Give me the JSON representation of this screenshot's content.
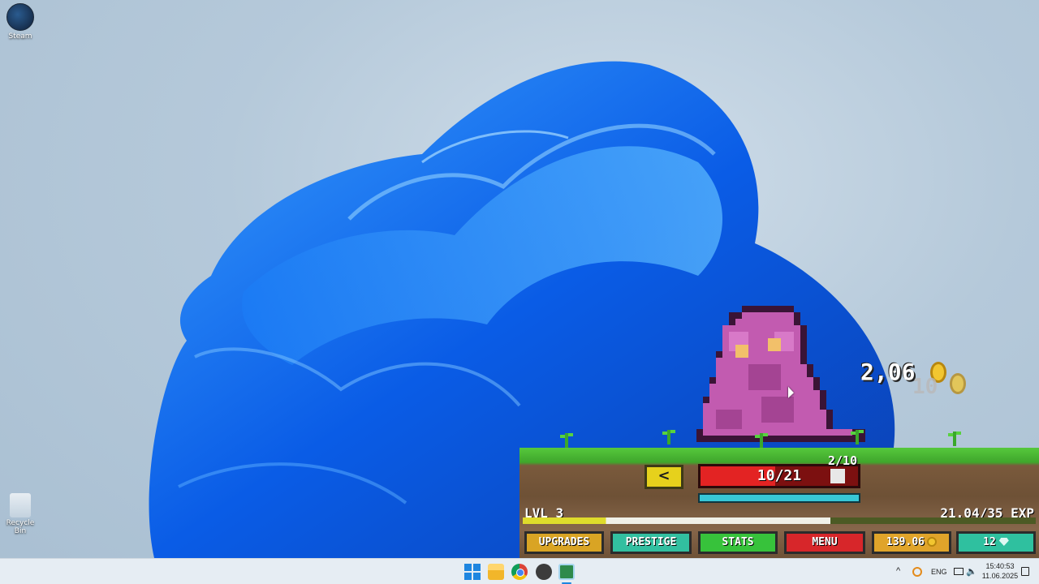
{
  "desktop": {
    "icons": [
      {
        "label": "Steam"
      },
      {
        "label": "Recycle Bin"
      }
    ]
  },
  "game": {
    "damage_number": "2,06",
    "damage_number_faded": "10",
    "wave_counter": "2/10",
    "enemy_hp": {
      "text": "10/21",
      "fraction": 0.476
    },
    "shield_fraction": 1.0,
    "level_label": "LVL 3",
    "exp_text": "21.04/35 EXP",
    "exp_fraction": 0.6,
    "back_button": "<",
    "buttons": {
      "upgrades": "UPGRADES",
      "prestige": "PRESTIGE",
      "stats": "STATS",
      "menu": "MENU"
    },
    "gold": "139.06",
    "gems": "12",
    "colors": {
      "grass": "#3fa62c",
      "hp_red": "#e32323",
      "shield_cyan": "#38c7d6",
      "slime": "#c25bb0"
    }
  },
  "taskbar": {
    "apps": [
      "start-icon",
      "file-explorer-icon",
      "chrome-icon",
      "unity-icon",
      "game-icon"
    ],
    "tray": {
      "language": "ENG",
      "time": "15:40:53",
      "date": "11.06.2025"
    }
  }
}
